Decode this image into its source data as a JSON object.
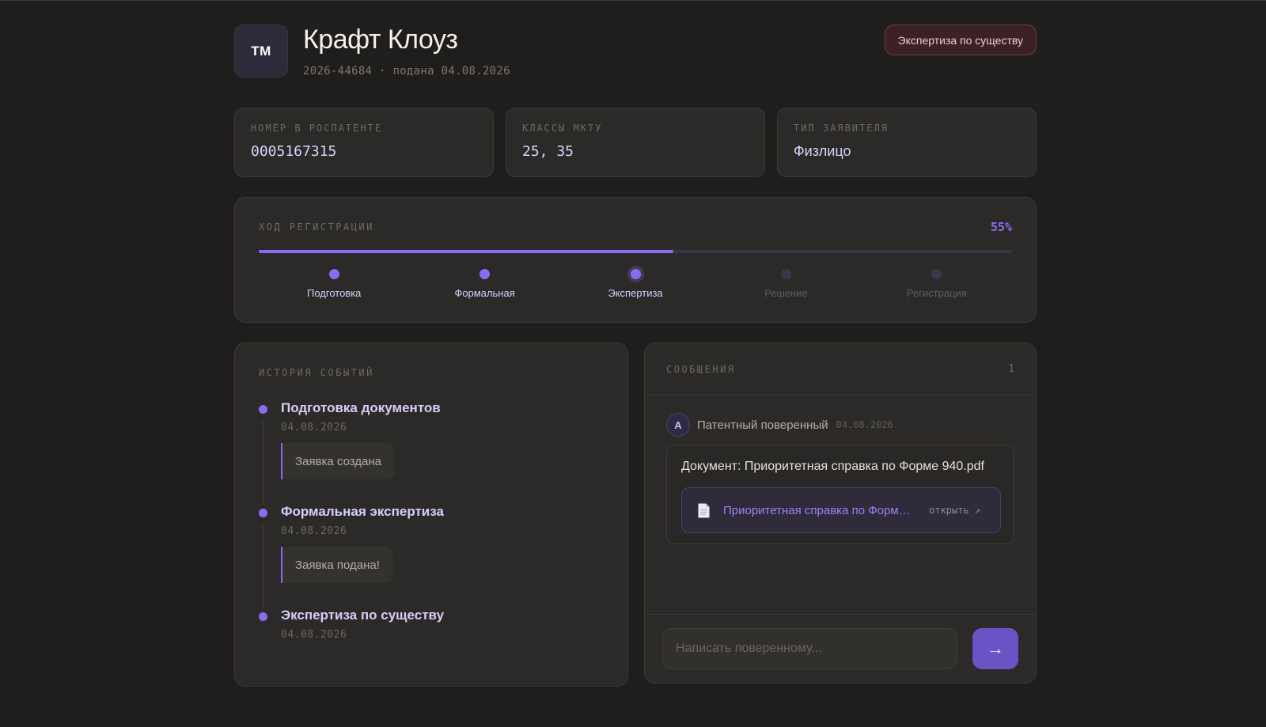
{
  "header": {
    "badge": "TM",
    "title": "Крафт Клоуз",
    "subtitle": "2026-44684 · подана 04.08.2026",
    "status": "Экспертиза по существу"
  },
  "cards": [
    {
      "label": "НОМЕР В РОСПАТЕНТЕ",
      "value": "0005167315"
    },
    {
      "label": "КЛАССЫ МКТУ",
      "value": "25, 35"
    },
    {
      "label": "ТИП ЗАЯВИТЕЛЯ",
      "value": "Физлицо"
    }
  ],
  "progress": {
    "label": "ХОД РЕГИСТРАЦИИ",
    "percent_label": "55%",
    "percent": 55,
    "steps": [
      {
        "label": "Подготовка",
        "state": "done"
      },
      {
        "label": "Формальная",
        "state": "done"
      },
      {
        "label": "Экспертиза",
        "state": "current"
      },
      {
        "label": "Решение",
        "state": "pending"
      },
      {
        "label": "Регистрация",
        "state": "pending"
      }
    ]
  },
  "history": {
    "label": "ИСТОРИЯ СОБЫТИЙ",
    "events": [
      {
        "title": "Подготовка документов",
        "date": "04.08.2026",
        "note": "Заявка создана"
      },
      {
        "title": "Формальная экспертиза",
        "date": "04.08.2026",
        "note": "Заявка подана!"
      },
      {
        "title": "Экспертиза по существу",
        "date": "04.08.2026"
      }
    ]
  },
  "messages": {
    "label": "СООБЩЕНИЯ",
    "count": "1",
    "items": [
      {
        "avatar": "A",
        "author": "Патентный поверенный",
        "date": "04.08.2026",
        "text": "Документ: Приоритетная справка по Форме 940.pdf",
        "attachment": {
          "name": "Приоритетная справка по Форме 940.pdf",
          "open_label": "открыть ↗",
          "icon": "document-icon"
        }
      }
    ],
    "compose": {
      "placeholder": "Написать поверенному...",
      "send_icon": "→"
    }
  },
  "colors": {
    "background": "#1f1e1c",
    "card": "#2c2a28",
    "accent": "#8b6cf0",
    "status_bg": "#3b2025",
    "status_border": "#7a3a45"
  }
}
